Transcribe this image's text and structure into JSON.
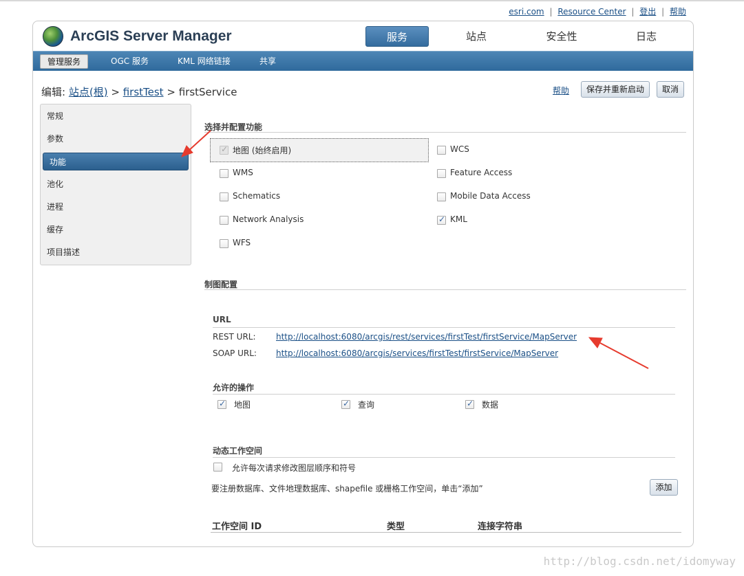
{
  "toplinks": [
    "esri.com",
    "Resource Center",
    "登出",
    "帮助"
  ],
  "app": {
    "title": "ArcGIS Server Manager"
  },
  "main_tabs": [
    "服务",
    "站点",
    "安全性",
    "日志"
  ],
  "sub_tabs": [
    "管理服务",
    "OGC 服务",
    "KML 网络链接",
    "共享"
  ],
  "breadcrumb": {
    "prefix": "编辑:",
    "site": "站点(根)",
    "sep1": ">",
    "folder": "firstTest",
    "sep2": ">",
    "service": "firstService"
  },
  "actions": {
    "help": "帮助",
    "save_restart": "保存并重新启动",
    "cancel": "取消"
  },
  "sidebar": {
    "items": [
      "常规",
      "参数",
      "功能",
      "池化",
      "进程",
      "缓存",
      "项目描述"
    ],
    "active": "功能"
  },
  "capabilities": {
    "title": "选择并配置功能",
    "left": [
      {
        "label": "地图 (始终启用)",
        "checked": true,
        "disabled": true
      },
      {
        "label": "WMS",
        "checked": false
      },
      {
        "label": "Schematics",
        "checked": false
      },
      {
        "label": "Network Analysis",
        "checked": false
      },
      {
        "label": "WFS",
        "checked": false
      }
    ],
    "right": [
      {
        "label": "WCS",
        "checked": false
      },
      {
        "label": "Feature Access",
        "checked": false
      },
      {
        "label": "Mobile Data Access",
        "checked": false
      },
      {
        "label": "KML",
        "checked": true
      }
    ]
  },
  "mapping": {
    "title": "制图配置",
    "url_title": "URL",
    "rest_label": "REST URL:",
    "rest_url": "http://localhost:6080/arcgis/rest/services/firstTest/firstService/MapServer",
    "soap_label": "SOAP URL:",
    "soap_url": "http://localhost:6080/arcgis/services/firstTest/firstService/MapServer",
    "ops_title": "允许的操作",
    "ops": [
      {
        "label": "地图",
        "checked": true
      },
      {
        "label": "查询",
        "checked": true
      },
      {
        "label": "数据",
        "checked": true
      }
    ],
    "dyn_title": "动态工作空间",
    "dyn_checkbox_label": "允许每次请求修改图层顺序和符号",
    "dyn_note": "要注册数据库、文件地理数据库、shapefile 或栅格工作空间，单击“添加”",
    "add_button": "添加",
    "table_headers": [
      "工作空间 ID",
      "类型",
      "连接字符串"
    ]
  },
  "watermark": "http://blog.csdn.net/idomyway",
  "colors": {
    "nav_blue": "#2f6a9c",
    "link": "#1a4f86",
    "annotation_arrow": "#e63b2e"
  }
}
